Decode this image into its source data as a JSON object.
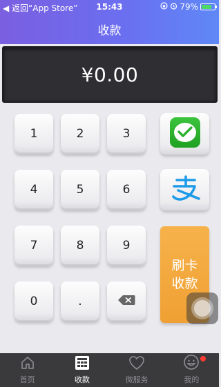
{
  "status_bar": {
    "back_label": "◀ 返回“App Store”",
    "time": "15:43",
    "battery_text": "79%",
    "battery_level": 0.79
  },
  "nav": {
    "title": "收款"
  },
  "amount": {
    "value": "¥0.00"
  },
  "keypad": {
    "keys": [
      "1",
      "2",
      "3",
      "4",
      "5",
      "6",
      "7",
      "8",
      "9",
      "0",
      "."
    ]
  },
  "side": {
    "card_line1": "刷卡",
    "card_line2": "收款"
  },
  "tabs": [
    {
      "label": "首页",
      "icon": "home-icon"
    },
    {
      "label": "收款",
      "icon": "grid-icon"
    },
    {
      "label": "微服务",
      "icon": "heart-icon"
    },
    {
      "label": "我的",
      "icon": "smiley-icon"
    }
  ],
  "colors": {
    "header_start": "#7a5fe0",
    "header_end": "#5f88f6",
    "card_button": "#f0a033",
    "wechat_green": "#2bb12e",
    "alipay_blue": "#1e9be8",
    "badge_red": "#ff3b30"
  }
}
